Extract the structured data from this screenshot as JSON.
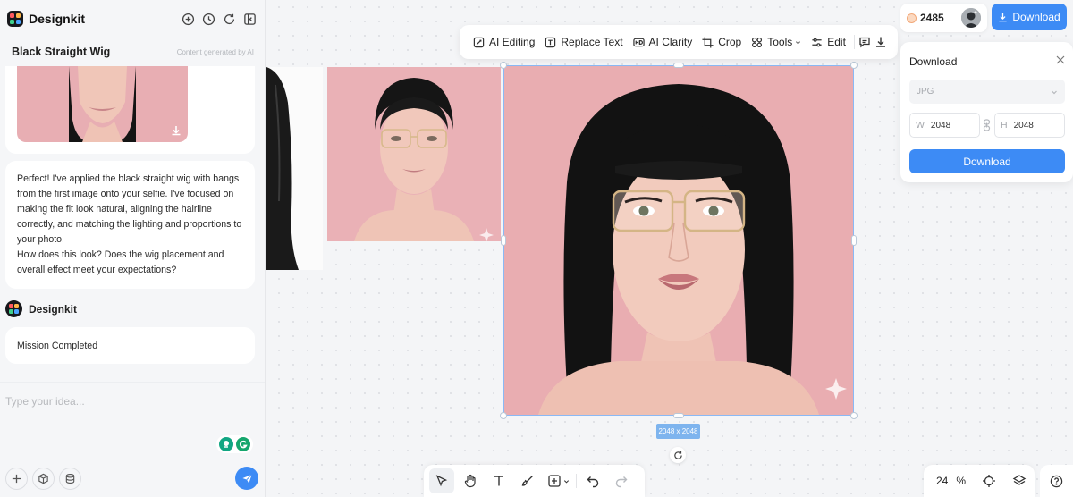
{
  "brand": {
    "name": "Designkit",
    "logo_colors": [
      "#ff5a5f",
      "#ffb648",
      "#3fd08c",
      "#4aa3ff"
    ]
  },
  "header_tools": [
    "add-chat-icon",
    "history-icon",
    "refresh-icon",
    "panel-collapse-icon"
  ],
  "chat": {
    "title": "Black Straight Wig",
    "disclaimer": "Content generated by AI",
    "message": "Perfect! I've applied the black straight wig with bangs from the first image onto your selfie. I've focused on making the fit look natural, aligning the hairline correctly, and matching the lighting and proportions to your photo.\nHow does this look? Does the wig placement and overall effect meet your expectations?",
    "sender": "Designkit",
    "status": "Mission Completed",
    "input_placeholder": "Type your idea..."
  },
  "toolbar": {
    "ai_editing": "AI Editing",
    "replace_text": "Replace Text",
    "ai_clarity": "AI Clarity",
    "crop": "Crop",
    "tools": "Tools",
    "edit": "Edit"
  },
  "account": {
    "credits": "2485",
    "download_button": "Download"
  },
  "download_panel": {
    "title": "Download",
    "format": "JPG",
    "width_prefix": "W",
    "width": "2048",
    "height_prefix": "H",
    "height": "2048",
    "confirm": "Download"
  },
  "canvas": {
    "dimension_label": "2048 x 2048",
    "accent": "#3d8bf5",
    "background_pink": "#e9adb1"
  },
  "zoom": {
    "value": "24",
    "unit": "%"
  }
}
